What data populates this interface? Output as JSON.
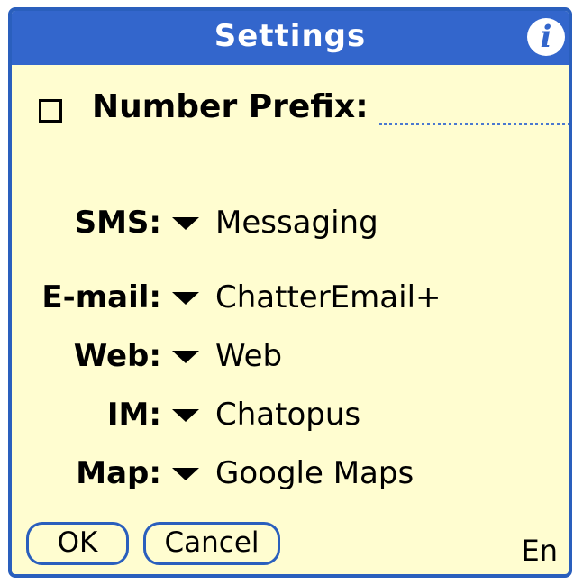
{
  "window": {
    "title": "Settings",
    "info_icon": "info-icon"
  },
  "prefix": {
    "label": "Number Prefix:",
    "checked": false,
    "value": ""
  },
  "rows": [
    {
      "label": "SMS:",
      "value": "Messaging"
    },
    {
      "label": "E-mail:",
      "value": "ChatterEmail+"
    },
    {
      "label": "Web:",
      "value": "Web"
    },
    {
      "label": "IM:",
      "value": "Chatopus"
    },
    {
      "label": "Map:",
      "value": "Google Maps"
    }
  ],
  "buttons": {
    "ok_label": "OK",
    "cancel_label": "Cancel"
  },
  "status": {
    "input_mode": "En"
  },
  "colors": {
    "title_bar": "#3366cc",
    "background": "#fffdd0",
    "border": "#2a5fbd"
  }
}
